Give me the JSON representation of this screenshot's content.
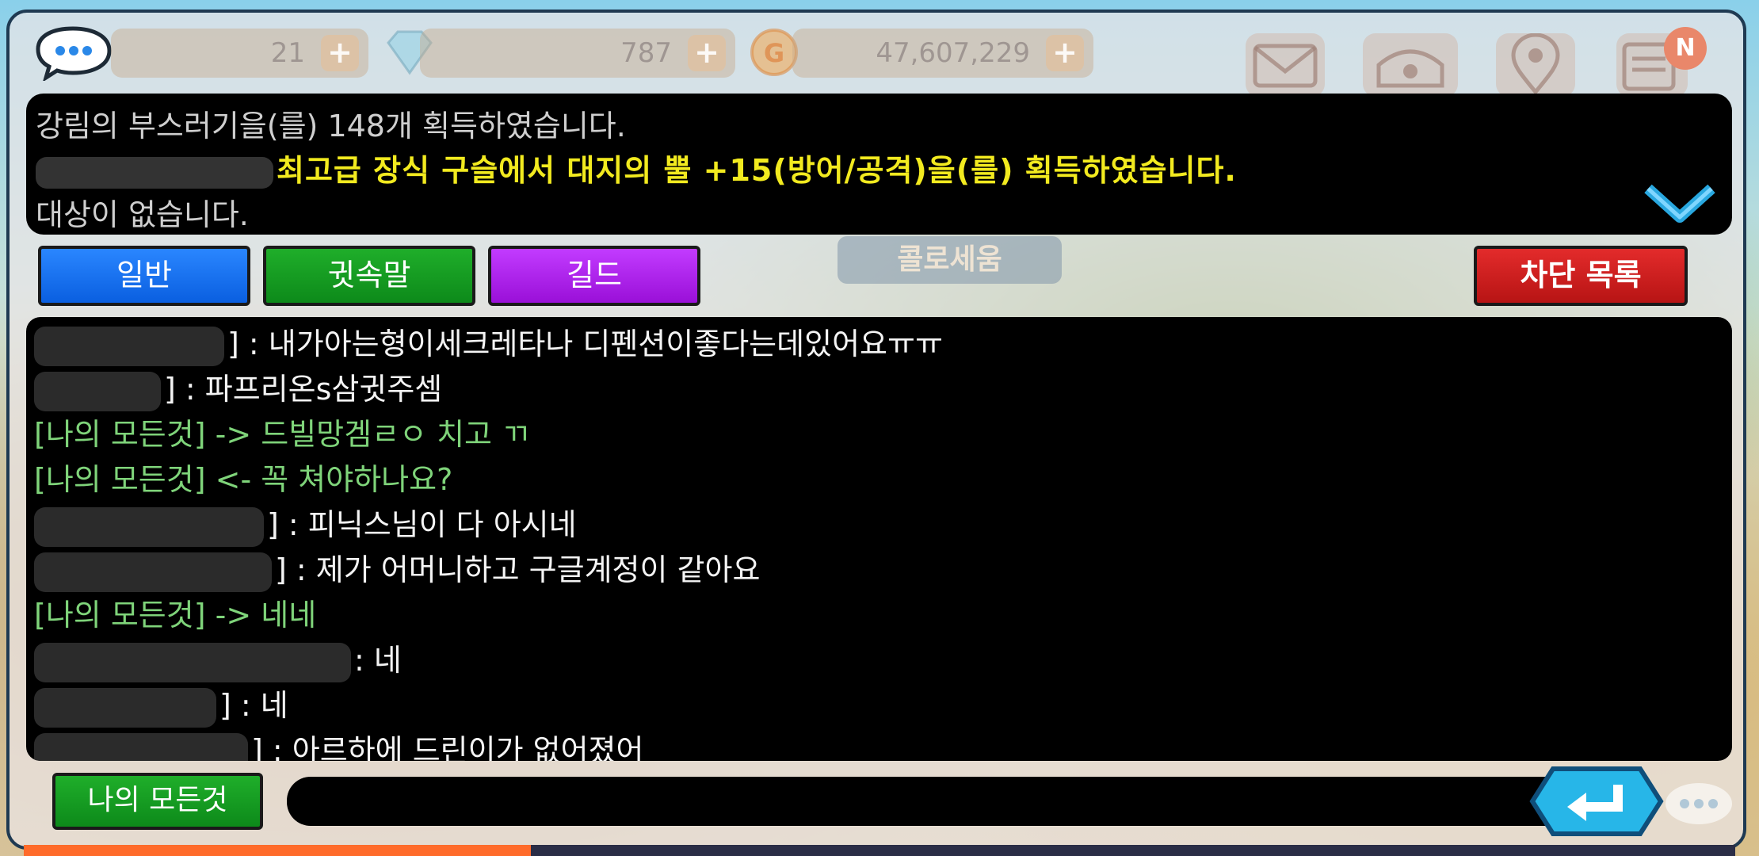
{
  "hud": {
    "resource1": "21",
    "resource2": "787",
    "gold": "47,607,229",
    "plus": "+",
    "notification_badge": "N"
  },
  "system_messages": {
    "line1": "강림의 부스러기을(를) 148개 획득하였습니다.",
    "line2": "최고급 장식 구슬에서 대지의 뿔 +15(방어/공격)을(를) 획득하였습니다.",
    "line3": "대상이 없습니다."
  },
  "tabs": {
    "general": "일반",
    "whisper": "귓속말",
    "guild": "길드",
    "block_list": "차단 목록"
  },
  "background_label": "콜로세움",
  "chat": [
    {
      "type": "white",
      "redact": 240,
      "text": "] : 내가아는형이세크레타나 디펜션이좋다는데있어요ㅠㅠ"
    },
    {
      "type": "white",
      "redact": 160,
      "text": "] : 파프리온s삼귓주셈"
    },
    {
      "type": "green",
      "redact": 0,
      "text": "[나의 모든것] -> 드빌망겜ㄹㅇ 치고 ㄲ"
    },
    {
      "type": "green",
      "redact": 0,
      "text": "[나의 모든것] <- 꼭 쳐야하나요?"
    },
    {
      "type": "white",
      "redact": 290,
      "text": "] : 피닉스님이 다 아시네"
    },
    {
      "type": "white",
      "redact": 300,
      "text": "] : 제가 어머니하고 구글계정이 같아요"
    },
    {
      "type": "green",
      "redact": 0,
      "text": "[나의 모든것] -> 네네"
    },
    {
      "type": "white",
      "redact": 400,
      "text": ": 네"
    },
    {
      "type": "white",
      "redact": 230,
      "text": "] : 네"
    },
    {
      "type": "white",
      "redact": 270,
      "text": "] : 아르하에 드린이가 없어졌어"
    }
  ],
  "bottom": {
    "my_name_button": "나의 모든것",
    "input_value": ""
  },
  "colors": {
    "system_highlight": "#f2ea1f",
    "whisper_green": "#7fd47a",
    "tab_blue": "#2a86ff",
    "tab_green": "#1fae2a",
    "tab_purple": "#c23bff",
    "tab_red": "#e32b2b",
    "send_cyan": "#27b6e8"
  }
}
